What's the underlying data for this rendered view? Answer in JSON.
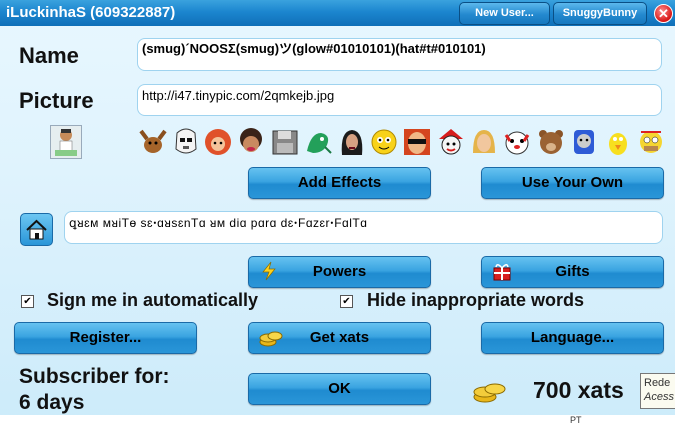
{
  "window": {
    "title": "iLuckinhaS (609322887)",
    "new_user_label": "New User...",
    "user_label": "SnuggyBunny",
    "close_label": "✕"
  },
  "name": {
    "label": "Name",
    "value": "(smug)´NOOSΣ(smug)ツ(glow#01010101)(hat#t#010101)"
  },
  "picture": {
    "label": "Picture",
    "value": "http://i47.tinypic.com/2qmkejb.jpg"
  },
  "avatars": [
    "moose",
    "stormtrooper",
    "redhead",
    "girl",
    "disk",
    "dragon",
    "darkhair",
    "yellow",
    "glasses",
    "jester",
    "blond",
    "dog",
    "bear",
    "engine",
    "bird",
    "homer"
  ],
  "buttons": {
    "add_effects": "Add Effects",
    "use_your_own": "Use Your Own",
    "powers": "Powers",
    "gifts": "Gifts",
    "register": "Register...",
    "get_xats": "Get xats",
    "language": "Language...",
    "ok": "OK"
  },
  "status": {
    "value": "ꝗᴚɛᴍ ᴍᴚiTɵ sɛꞏɑᴚsɛnTɑ ᴚᴍ diɑ pɑrɑ dɛꞏFɑzɛrꞏFɑlTɑ"
  },
  "checkboxes": {
    "sign_in_label": "Sign me in automatically",
    "sign_in_checked": true,
    "hide_words_label": "Hide inappropriate words",
    "hide_words_checked": true
  },
  "subscriber": {
    "line1": "Subscriber for:",
    "line2": "6 days"
  },
  "xats": {
    "amount": "700 xats"
  },
  "tooltip": {
    "line1": "Rede",
    "line2": "Acess"
  },
  "taskbar": {
    "lang": "PT"
  },
  "colors": {
    "title_bar": "#1c86cf",
    "button": "#3aa4e1",
    "background": "#dff3fd"
  }
}
